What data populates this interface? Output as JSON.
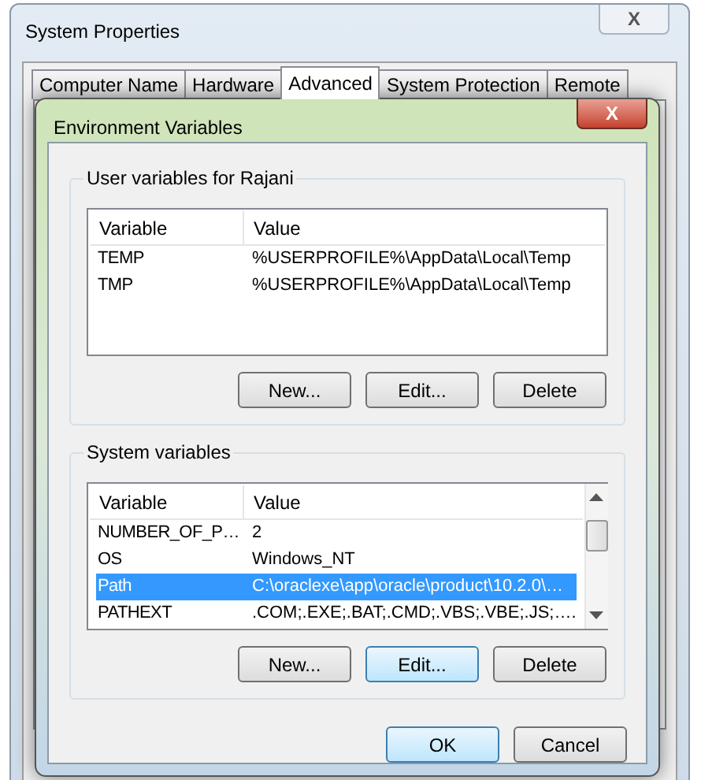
{
  "back_window": {
    "title": "System Properties",
    "close": "X",
    "tabs": [
      {
        "label": "Computer Name",
        "selected": false
      },
      {
        "label": "Hardware",
        "selected": false
      },
      {
        "label": "Advanced",
        "selected": true
      },
      {
        "label": "System Protection",
        "selected": false
      },
      {
        "label": "Remote",
        "selected": false
      }
    ]
  },
  "dialog": {
    "title": "Environment Variables",
    "close": "X",
    "groups": [
      {
        "title": "User variables for Rajani",
        "columns": [
          "Variable",
          "Value"
        ],
        "scrollbar": false,
        "rows": [
          {
            "cells": [
              "TEMP",
              "%USERPROFILE%\\AppData\\Local\\Temp"
            ],
            "selected": false
          },
          {
            "cells": [
              "TMP",
              "%USERPROFILE%\\AppData\\Local\\Temp"
            ],
            "selected": false
          }
        ],
        "buttons": [
          {
            "label": "New...",
            "highlighted": false
          },
          {
            "label": "Edit...",
            "highlighted": false
          },
          {
            "label": "Delete",
            "highlighted": false
          }
        ]
      },
      {
        "title": "System variables",
        "columns": [
          "Variable",
          "Value"
        ],
        "scrollbar": true,
        "rows": [
          {
            "cells": [
              "NUMBER_OF_P…",
              "2"
            ],
            "selected": false
          },
          {
            "cells": [
              "OS",
              "Windows_NT"
            ],
            "selected": false
          },
          {
            "cells": [
              "Path",
              "C:\\oraclexe\\app\\oracle\\product\\10.2.0\\…"
            ],
            "selected": true
          },
          {
            "cells": [
              "PATHEXT",
              ".COM;.EXE;.BAT;.CMD;.VBS;.VBE;.JS;…."
            ],
            "selected": false
          }
        ],
        "buttons": [
          {
            "label": "New...",
            "highlighted": false
          },
          {
            "label": "Edit...",
            "highlighted": true
          },
          {
            "label": "Delete",
            "highlighted": false
          }
        ]
      }
    ],
    "buttons": [
      {
        "label": "OK",
        "highlighted": true
      },
      {
        "label": "Cancel",
        "highlighted": false
      }
    ]
  }
}
